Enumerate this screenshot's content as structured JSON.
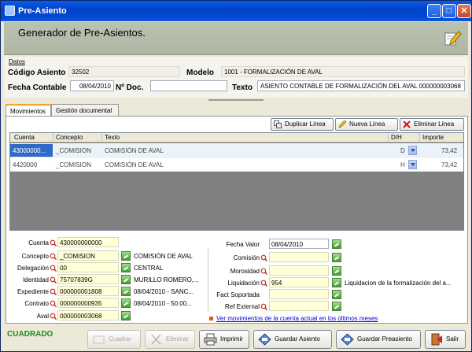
{
  "window": {
    "title": "Pre-Asiento"
  },
  "header": {
    "title": "Generador de Pre-Asientos."
  },
  "datos": {
    "section_label": "Datos",
    "codigo_label": "Código Asiento",
    "codigo_value": "32502",
    "modelo_label": "Modelo",
    "modelo_value": "1001 - FORMALIZACIÓN DE AVAL",
    "fecha_label": "Fecha Contable",
    "fecha_value": "08/04/2010",
    "ndoc_label": "Nº Doc.",
    "ndoc_value": "",
    "texto_label": "Texto",
    "texto_value": "ASIENTO CONTABLE DE FORMALIZACIÓN DEL AVAL 000000003068"
  },
  "tabs": [
    {
      "label": "Movimientos"
    },
    {
      "label": "Gestión documental"
    }
  ],
  "grid_toolbar": {
    "duplicar": "Duplicar Línea",
    "nueva": "Nueva Línea",
    "eliminar": "Eliminar Línea"
  },
  "grid": {
    "columns": [
      "Cuenta",
      "Concepto",
      "Texto",
      "D/H",
      "Importe"
    ],
    "rows": [
      {
        "cuenta": "43000000...",
        "concepto": "_COMISION",
        "texto": "COMISIÓN DE AVAL",
        "dh": "D",
        "importe": "73,42"
      },
      {
        "cuenta": "4420000",
        "concepto": "_COMISION",
        "texto": "COMISIÓN DE AVAL",
        "dh": "H",
        "importe": "73,42"
      }
    ]
  },
  "form_left": {
    "cuenta_label": "Cuenta",
    "cuenta_value": "430000000000",
    "concepto_label": "Concepto",
    "concepto_value": "_COMISION",
    "concepto_desc": "COMISIÓN DE AVAL",
    "delegacion_label": "Delegación",
    "delegacion_value": "00",
    "delegacion_desc": "CENTRAL",
    "identidad_label": "Identidad",
    "identidad_value": "75707839G",
    "identidad_desc": "MURILLO ROMERO,...",
    "expediente_label": "Expediente",
    "expediente_value": "000000001808",
    "expediente_desc": "08/04/2010 - SANC...",
    "contrato_label": "Contrato",
    "contrato_value": "000000000935",
    "contrato_desc": "08/04/2010 - 50.00...",
    "aval_label": "Aval",
    "aval_value": "000000003068"
  },
  "form_right": {
    "fecha_valor_label": "Fecha Valor",
    "fecha_valor_value": "08/04/2010",
    "comision_label": "Comisión",
    "comision_value": "",
    "morosidad_label": "Morosidad",
    "morosidad_value": "",
    "liquidacion_label": "Liquidación",
    "liquidacion_value": "954",
    "liquidacion_desc": "Liquidacion de la formalización del a...",
    "fact_label": "Fact Soportada",
    "fact_value": "",
    "ref_label": "Ref External",
    "ref_value": ""
  },
  "link": {
    "text": "Ver movimientos de la cuenta actual en los últimos meses"
  },
  "status": {
    "text": "CUADRADO"
  },
  "buttons": {
    "cuadrar": "Cuadrar",
    "eliminar": "Eliminar",
    "imprimir": "Imprimir",
    "guardar_asiento": "Guardar Asiento",
    "guardar_preasiento": "Guardar Preasiento",
    "salir": "Salir"
  }
}
